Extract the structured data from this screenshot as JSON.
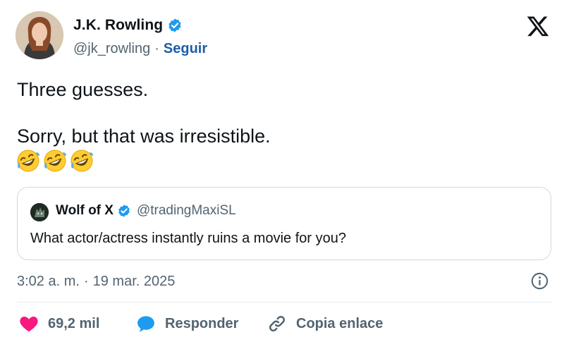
{
  "author": {
    "name": "J.K. Rowling",
    "handle": "@jk_rowling",
    "separator": "·",
    "follow_label": "Seguir",
    "avatar_icon": "author-avatar",
    "verified_icon": "verified-badge-icon"
  },
  "platform": {
    "logo": "x-logo-icon"
  },
  "tweet": {
    "lines": [
      "Three guesses.",
      "Sorry, but that was irresistible."
    ],
    "emojis": [
      "🤣",
      "🤣",
      "🤣"
    ]
  },
  "quote": {
    "name": "Wolf of X",
    "handle": "@tradingMaxiSL",
    "text": "What actor/actress instantly ruins a movie for you?"
  },
  "meta": {
    "time": "3:02 a. m.",
    "separator": "·",
    "date": "19 mar. 2025"
  },
  "actions": {
    "likes": "69,2 mil",
    "reply": "Responder",
    "copy_link": "Copia enlace"
  },
  "colors": {
    "text": "#0f1419",
    "secondary": "#536471",
    "follow": "#1d5ea8",
    "verified": "#1d9bf0",
    "like": "#f91880",
    "reply": "#1d9bf0",
    "border": "#cfd9de"
  }
}
